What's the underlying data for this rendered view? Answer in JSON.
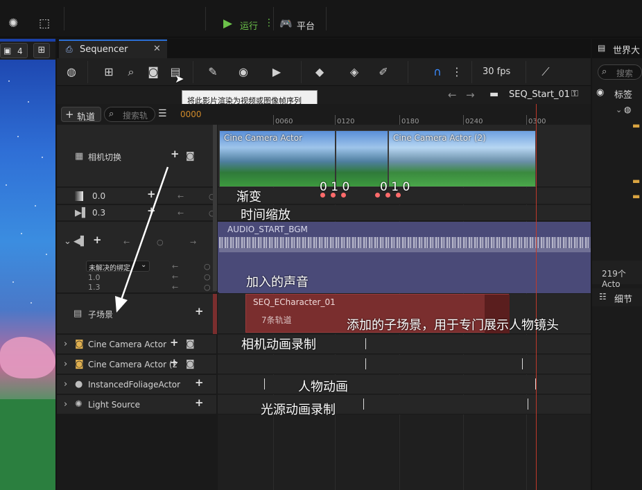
{
  "topbar": {
    "run_label": "运行",
    "platform_label": "平台"
  },
  "viewport": {
    "camera_count": "4"
  },
  "sequencer": {
    "tab_title": "Sequencer",
    "fps": "30 fps",
    "tooltip": "将此影片渲染为视频或图像帧序列",
    "sequence_name": "SEQ_Start_01",
    "add_track_label": "轨道",
    "search_placeholder": "搜索轨",
    "current_frame": "0000",
    "ticks": [
      "0060",
      "0120",
      "0180",
      "0240",
      "0300"
    ]
  },
  "tracks": {
    "camera_cuts": "相机切换",
    "fade_value": "0.0",
    "time_dilation_value": "0.3",
    "unresolved_binding": "未解决的绑定",
    "audio_value_1": "1.0",
    "audio_value_2": "1.3",
    "subscene": "子场景",
    "cine_camera_1": "Cine Camera Actor",
    "cine_camera_2": "Cine Camera Actor (2",
    "foliage": "InstancedFoliageActor",
    "light": "Light Source"
  },
  "clips": {
    "cam1": "Cine Camera Actor",
    "cam2": "Cine Camera Actor (2)",
    "audio": "AUDIO_START_BGM",
    "subscene": "SEQ_ECharacter_01",
    "subscene_tracks": "7条轨道",
    "key_labels_1": "0 1 0",
    "key_labels_2": "0 1 0"
  },
  "annotations": {
    "fade": "渐变",
    "time_scale": "时间缩放",
    "sound": "加入的声音",
    "subscene": "添加的子场景，用于专门展示人物镜头",
    "camera_anim": "相机动画录制",
    "character_anim": "人物动画",
    "light_anim": "光源动画录制"
  },
  "right_panel": {
    "world_label": "世界大",
    "search_placeholder": "搜索",
    "tags_label": "标签",
    "actor_count": "219个Acto",
    "details_label": "细节"
  },
  "colors": {
    "accent_blue": "#2a6fd6",
    "run_green": "#6cc24a",
    "current_frame": "#d08a2a",
    "playhead": "#c0392b",
    "audio_track": "#4a4a78",
    "subscene_clip": "#7a2e2e"
  }
}
